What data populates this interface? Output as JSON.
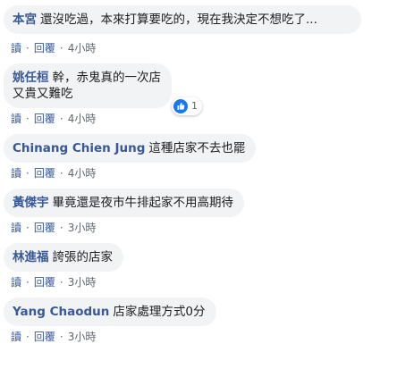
{
  "comments": [
    {
      "author": "本宮",
      "text": "還沒吃過，本來打算要吃的，現在我決定不想吃了...",
      "reply_label": "讀",
      "reply2_label": "回覆",
      "time": "4小時"
    },
    {
      "author": "姚任桓",
      "text_line1": "幹，赤鬼真的一次店",
      "text_line2": "又貴又難吃",
      "reply_label": "讀",
      "reply2_label": "回覆",
      "time": "4小時",
      "reaction_count": "1",
      "reaction_icon": "like-icon"
    },
    {
      "author": "Chinang Chien Jung",
      "text": "這種店家不去也罷",
      "reply_label": "讀",
      "reply2_label": "回覆",
      "time": "4小時"
    },
    {
      "author": "黃傑宇",
      "text": "畢竟還是夜市牛排起家不用高期待",
      "reply_label": "讀",
      "reply2_label": "回覆",
      "time": "3小時"
    },
    {
      "author": "林進福",
      "text": "誇張的店家",
      "reply_label": "讀",
      "reply2_label": "回覆",
      "time": "3小時"
    },
    {
      "author": "Yang Chaodun",
      "text": "店家處理方式0分",
      "reply_label": "讀",
      "reply2_label": "回覆",
      "time": "3小時"
    }
  ],
  "colors": {
    "author": "#385898",
    "bubble": "#f2f3f5",
    "like": "#1877f2"
  }
}
